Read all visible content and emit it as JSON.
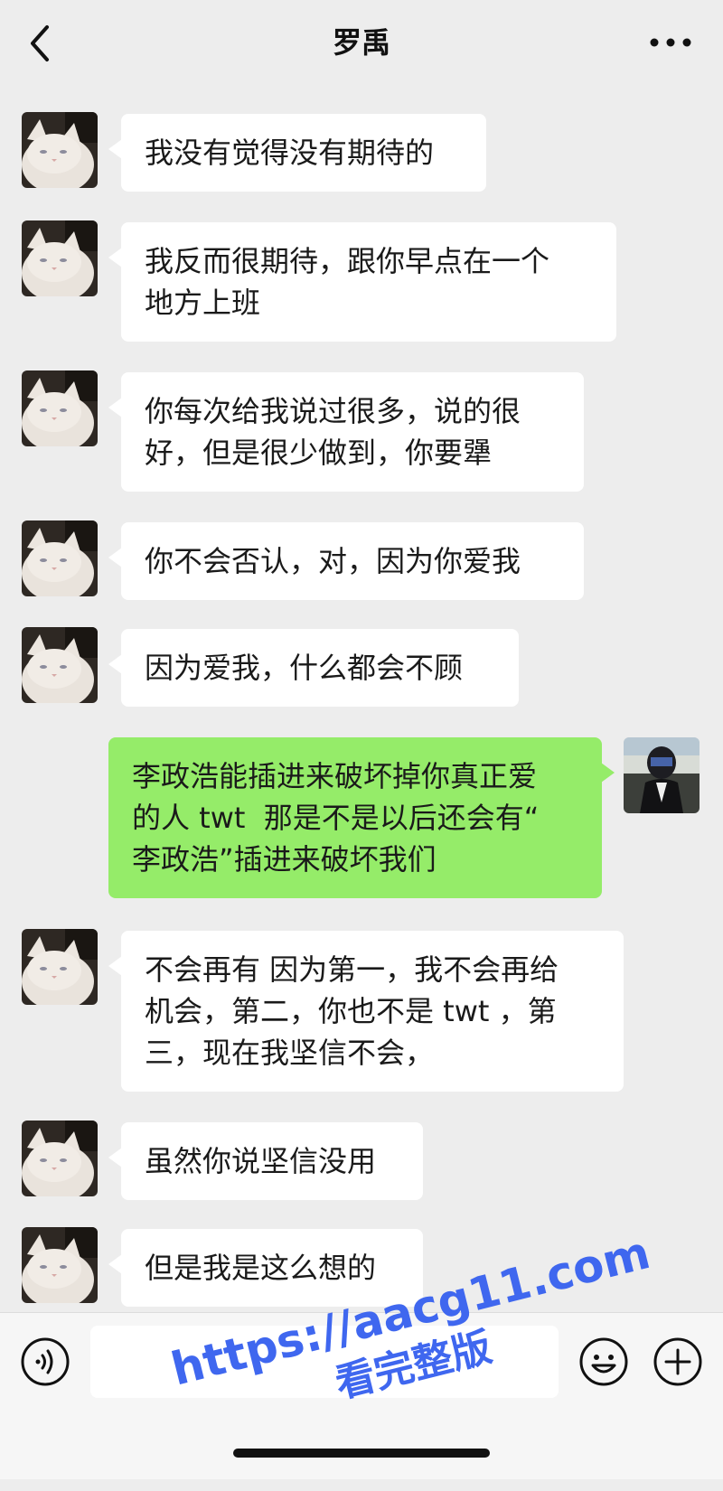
{
  "header": {
    "title": "罗禹",
    "back_icon": "chevron-left-icon",
    "more_icon": "more-dots-icon"
  },
  "messages": [
    {
      "side": "left",
      "text": "我没有觉得没有期待的"
    },
    {
      "side": "left",
      "text": "我反而很期待，跟你早点在一个\n地方上班"
    },
    {
      "side": "left",
      "text": "你每次给我说过很多，说的很\n好，但是很少做到，你要犟"
    },
    {
      "side": "left",
      "text": "你不会否认，对，因为你爱我"
    },
    {
      "side": "left",
      "text": "因为爱我，什么都会不顾"
    },
    {
      "side": "right",
      "text": "李政浩能插进来破坏掉你真正爱\n的人 twt  那是不是以后还会有“\n李政浩”插进来破坏我们"
    },
    {
      "side": "left",
      "text": "不会再有 因为第一，我不会再给\n机会，第二，你也不是 twt ，第\n三，现在我坚信不会，"
    },
    {
      "side": "left",
      "text": "虽然你说坚信没用"
    },
    {
      "side": "left",
      "text": "但是我是这么想的"
    }
  ],
  "input_bar": {
    "voice_icon": "voice-icon",
    "text_value": "",
    "emoji_icon": "emoji-icon",
    "plus_icon": "plus-icon"
  },
  "watermark": {
    "line1": "https://aacg11.com",
    "line2": "看完整版"
  },
  "colors": {
    "background": "#ededed",
    "bubble_left": "#ffffff",
    "bubble_right": "#95ec69",
    "watermark": "#3f67ef"
  }
}
